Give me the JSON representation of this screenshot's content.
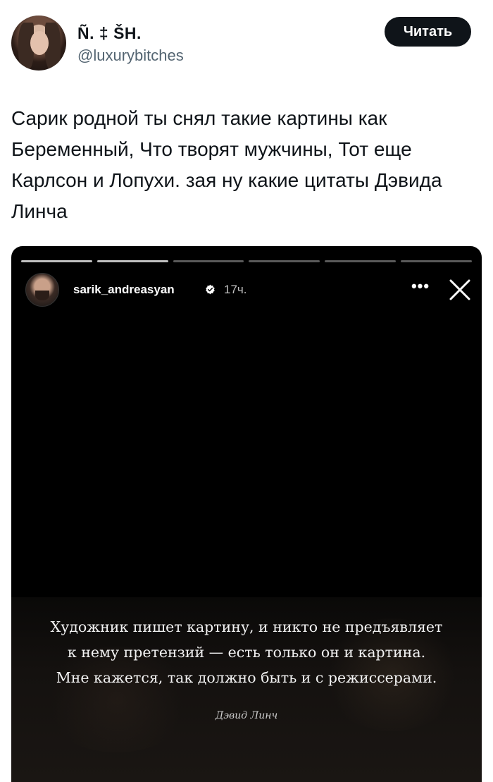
{
  "tweet": {
    "author": {
      "display_name": "Ñ. ‡ ŠH.",
      "handle": "@luxurybitches"
    },
    "follow_label": "Читать",
    "text": "Сарик родной ты снял такие картины как Беременный, Что творят мужчины, Тот еще Карлсон и Лопухи. зая ну какие цитаты Дэвида Линча"
  },
  "story": {
    "progress": {
      "segments": 6,
      "completed": 2
    },
    "username": "sarik_andreasyan",
    "verified": true,
    "time": "17ч.",
    "more_icon": "more-horizontal-icon",
    "close_icon": "close-icon",
    "quote": {
      "lines": [
        "Художник пишет картину, и никто не предъявляет",
        "к нему претензий — есть только он и картина.",
        "Мне кажется, так должно быть и с режиссерами."
      ],
      "author": "Дэвид Линч"
    }
  },
  "colors": {
    "button_bg": "#0f1419",
    "handle_text": "#536471",
    "story_bg": "#000000"
  }
}
